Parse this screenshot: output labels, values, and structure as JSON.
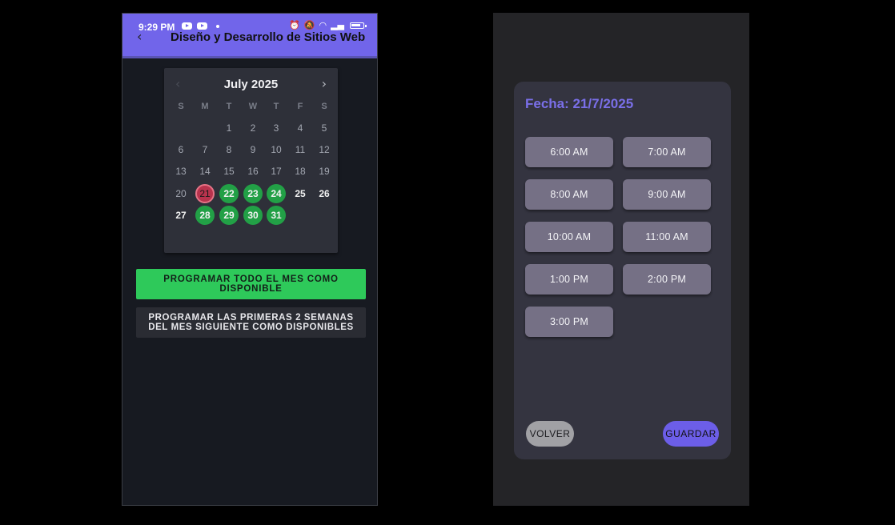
{
  "status_bar": {
    "time": "9:29 PM",
    "icons": [
      "youtube-icon",
      "youtube-icon",
      "notification-dot",
      "alarm-icon",
      "mute-icon",
      "wifi-icon",
      "signal-icon",
      "battery-icon"
    ]
  },
  "app_bar": {
    "title": "Diseño y Desarrollo de Sitios Web",
    "back_icon": "‹",
    "color": "#7165ea"
  },
  "calendar": {
    "month": "July 2025",
    "prev_icon": "‹",
    "next_icon": "›",
    "weekdays": [
      "S",
      "M",
      "T",
      "W",
      "T",
      "F",
      "S"
    ],
    "weeks": [
      [
        null,
        null,
        1,
        2,
        3,
        4,
        5
      ],
      [
        6,
        7,
        8,
        9,
        10,
        11,
        12
      ],
      [
        13,
        14,
        15,
        16,
        17,
        18,
        19
      ],
      [
        20,
        21,
        22,
        23,
        24,
        25,
        26
      ],
      [
        27,
        28,
        29,
        30,
        31,
        null,
        null
      ]
    ],
    "selected_day": 21,
    "available_days": [
      22,
      23,
      24,
      28,
      29,
      30,
      31
    ],
    "future_days": [
      25,
      26,
      27
    ],
    "colors": {
      "selected": "#b8334d",
      "available": "#22a046"
    }
  },
  "actions": {
    "schedule_month": "PROGRAMAR TODO EL MES COMO DISPONIBLE",
    "schedule_weeks": "PROGRAMAR LAS PRIMERAS 2 SEMANAS DEL MES SIGUIENTE COMO DISPONIBLES"
  },
  "time_dialog": {
    "date_label": "Fecha: 21/7/2025",
    "slots": [
      "6:00 AM",
      "7:00 AM",
      "8:00 AM",
      "9:00 AM",
      "10:00 AM",
      "11:00 AM",
      "1:00 PM",
      "2:00 PM",
      "3:00 PM"
    ],
    "back_label": "VOLVER",
    "save_label": "GUARDAR",
    "accent": "#6c5ee8"
  }
}
